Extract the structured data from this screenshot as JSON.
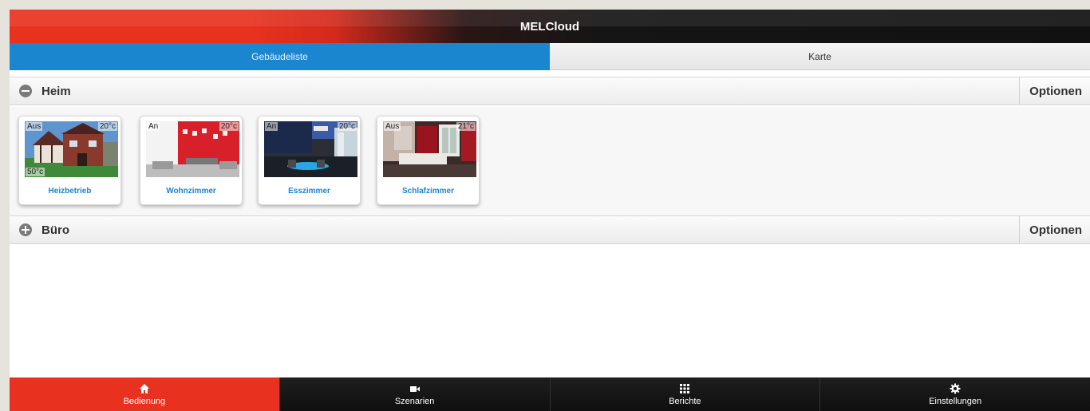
{
  "app": {
    "title": "MELCloud"
  },
  "tabs": [
    {
      "label": "Gebäudeliste",
      "active": true
    },
    {
      "label": "Karte",
      "active": false
    }
  ],
  "sections": [
    {
      "name": "Heim",
      "expanded": true,
      "options_label": "Optionen",
      "devices": [
        {
          "state": "Aus",
          "temp": "20°c",
          "extra": "50°c",
          "label": "Heizbetrieb",
          "icon": "house-photo"
        },
        {
          "state": "An",
          "temp": "20°c",
          "extra": "",
          "label": "Wohnzimmer",
          "icon": "living-room-photo"
        },
        {
          "state": "An",
          "temp": "20°c",
          "extra": "",
          "label": "Esszimmer",
          "icon": "dining-room-photo"
        },
        {
          "state": "Aus",
          "temp": "21°c",
          "extra": "",
          "label": "Schlafzimmer",
          "icon": "bedroom-photo"
        }
      ]
    },
    {
      "name": "Büro",
      "expanded": false,
      "options_label": "Optionen",
      "devices": []
    }
  ],
  "footer": [
    {
      "label": "Bedienung",
      "icon": "home-icon",
      "active": true
    },
    {
      "label": "Szenarien",
      "icon": "video-camera-icon",
      "active": false
    },
    {
      "label": "Berichte",
      "icon": "grid-icon",
      "active": false
    },
    {
      "label": "Einstellungen",
      "icon": "gear-icon",
      "active": false
    }
  ],
  "colors": {
    "accent_blue": "#1a86d0",
    "brand_red": "#e8321f",
    "dark_bar": "#111111"
  }
}
